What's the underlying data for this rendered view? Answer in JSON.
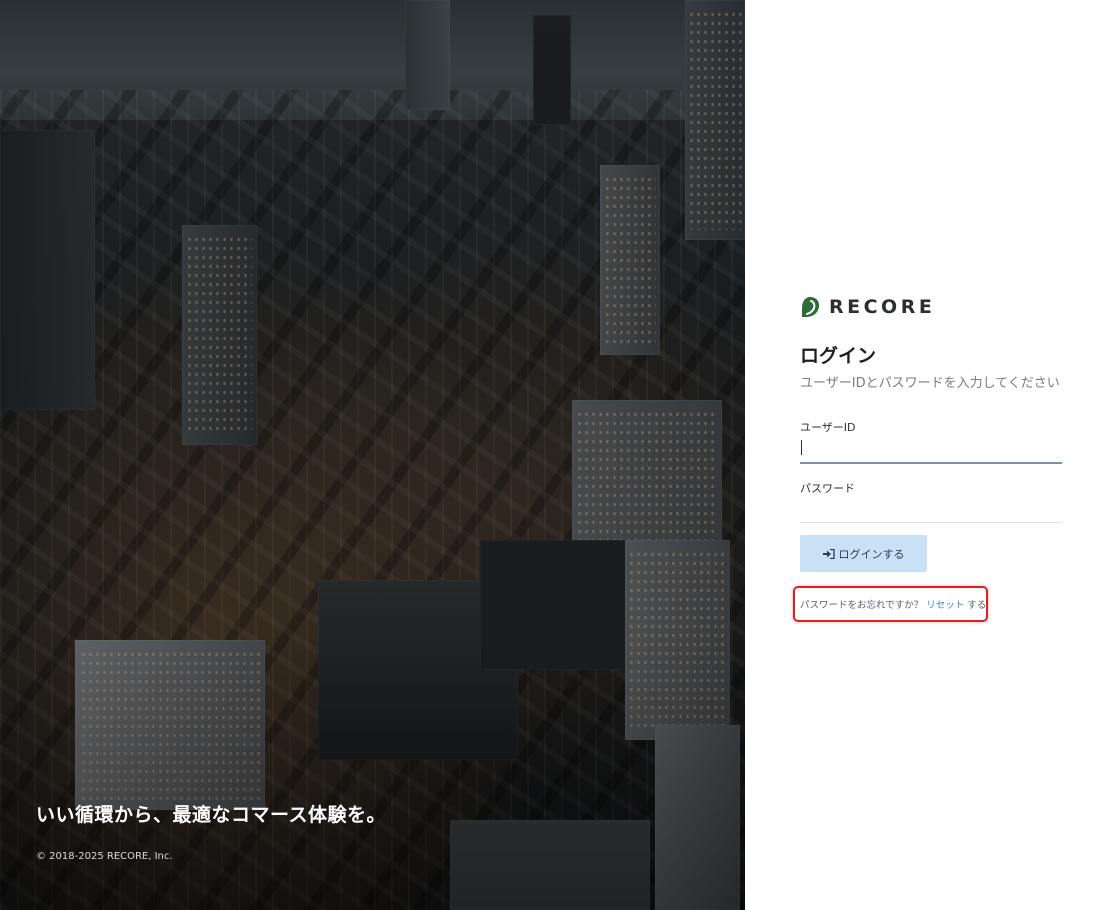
{
  "hero": {
    "tagline": "いい循環から、最適なコマース体験を。",
    "copyright": "© 2018-2025 RECORE, Inc."
  },
  "brand": {
    "name": "RECORE",
    "logo_icon": "recore-leaf-icon",
    "logo_color": "#2e6b3a"
  },
  "login": {
    "title": "ログイン",
    "subtitle": "ユーザーIDとパスワードを入力してください",
    "user_id_label": "ユーザーID",
    "user_id_value": "",
    "password_label": "パスワード",
    "password_value": "",
    "submit_label": "ログインする",
    "submit_icon": "sign-in-icon",
    "forgot_prefix": "パスワードをお忘れですか？",
    "reset_link": "リセット",
    "forgot_suffix": "する"
  },
  "colors": {
    "button_bg": "#c9e1f5",
    "link": "#3a86d1",
    "highlight_border": "#e02020"
  }
}
